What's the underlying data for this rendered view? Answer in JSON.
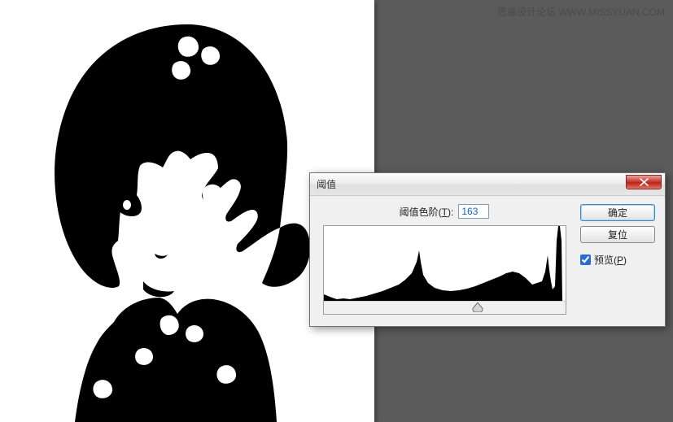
{
  "watermark": "思缘设计论坛  WWW.MISSYUAN.COM",
  "dialog": {
    "title": "阈值",
    "threshold_label_prefix": "阈值色阶(",
    "threshold_label_hotkey": "T",
    "threshold_label_suffix": "):",
    "threshold_value": "163",
    "ok_label": "确定",
    "reset_label": "复位",
    "preview_label_prefix": "预览(",
    "preview_label_hotkey": "P",
    "preview_label_suffix": ")",
    "preview_checked": true,
    "histogram_range": [
      0,
      255
    ]
  },
  "icons": {
    "close": "close-icon"
  }
}
